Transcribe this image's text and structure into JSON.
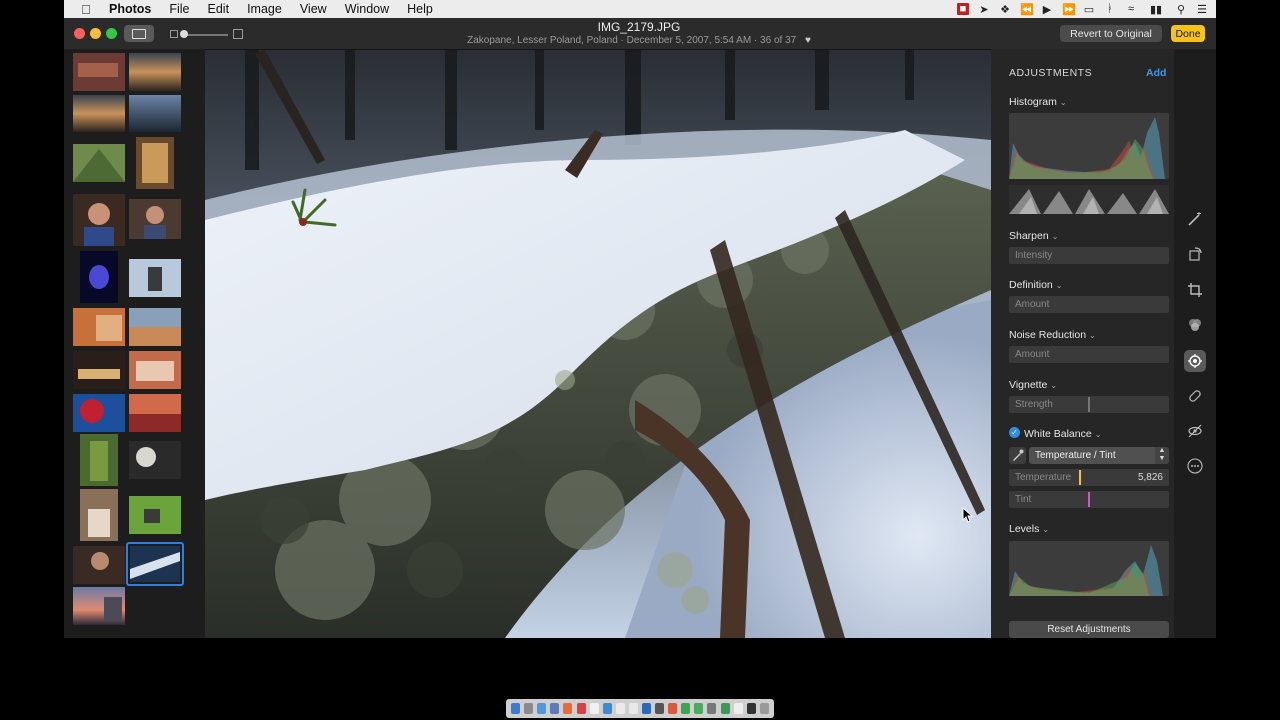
{
  "menubar": {
    "apple_icon": "apple-logo-icon",
    "app_name": "Photos",
    "items": [
      "File",
      "Edit",
      "Image",
      "View",
      "Window",
      "Help"
    ],
    "status_icons": [
      "screen-record-icon",
      "location-icon",
      "dropbox-icon",
      "rewind-icon",
      "play-icon",
      "fast-forward-icon",
      "airplay-icon",
      "bluetooth-icon",
      "wifi-icon",
      "battery-icon",
      "search-icon",
      "list-icon"
    ]
  },
  "toolbar": {
    "title": "IMG_2179.JPG",
    "meta": "Zakopane, Lesser Poland, Poland  ·  December 5, 2007, 5:54 AM  ·  36 of 37",
    "favorite_icon": "heart-icon",
    "revert_label": "Revert to Original",
    "done_label": "Done"
  },
  "adjustments": {
    "header": "ADJUSTMENTS",
    "add_label": "Add",
    "histogram_label": "Histogram",
    "sharpen_label": "Sharpen",
    "sharpen_field": "Intensity",
    "definition_label": "Definition",
    "definition_field": "Amount",
    "noise_label": "Noise Reduction",
    "noise_field": "Amount",
    "vignette_label": "Vignette",
    "vignette_field": "Strength",
    "wb_label": "White Balance",
    "wb_mode": "Temperature / Tint",
    "temperature_label": "Temperature",
    "temperature_value": "5,826",
    "tint_label": "Tint",
    "levels_label": "Levels",
    "reset_label": "Reset Adjustments"
  },
  "rail_icons": [
    "magic-wand-icon",
    "rotate-icon",
    "crop-icon",
    "filters-icon",
    "adjust-icon",
    "retouch-icon",
    "red-eye-icon",
    "more-icon"
  ],
  "colors": {
    "done": "#f6c318",
    "accent": "#3d9be9",
    "temperature_marker": "#f3c431",
    "tint_marker": "#d94fd6"
  }
}
